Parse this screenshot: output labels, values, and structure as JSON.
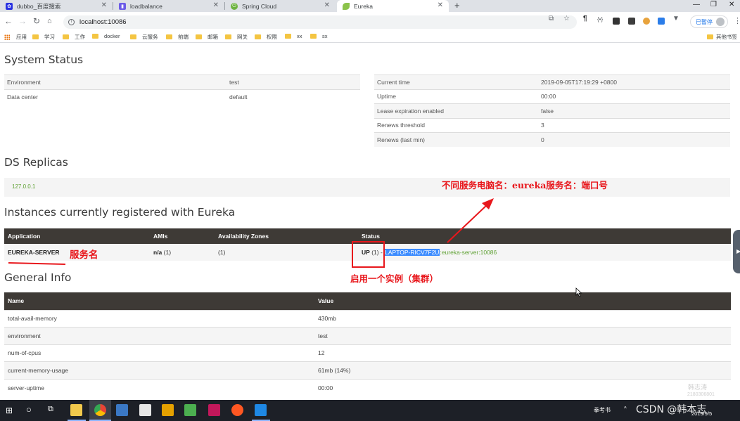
{
  "browser": {
    "tabs": [
      {
        "label": "dubbo_百度搜索",
        "icon": "baidu-paw-icon",
        "color": "#2932e1"
      },
      {
        "label": "loadbalance",
        "icon": "bookmark-page-icon",
        "color": "#6c5ce7"
      },
      {
        "label": "Spring Cloud",
        "icon": "spring-leaf-icon",
        "color": "#6db33f"
      },
      {
        "label": "Eureka",
        "icon": "eureka-leaf-icon",
        "color": "#8bc34a"
      }
    ],
    "url": "localhost:10086",
    "profile_label": "已暂停",
    "bookmarks": [
      "应用",
      "学习",
      "工作",
      "docker",
      "云服务",
      "前端",
      "邮箱",
      "网关",
      "权限",
      "xx",
      "sx"
    ],
    "other_bookmarks": "其他书签"
  },
  "system_status": {
    "title": "System Status",
    "left": [
      {
        "key": "Environment",
        "value": "test"
      },
      {
        "key": "Data center",
        "value": "default"
      }
    ],
    "right": [
      {
        "key": "Current time",
        "value": "2019-09-05T17:19:29 +0800"
      },
      {
        "key": "Uptime",
        "value": "00:00"
      },
      {
        "key": "Lease expiration enabled",
        "value": "false"
      },
      {
        "key": "Renews threshold",
        "value": "3"
      },
      {
        "key": "Renews (last min)",
        "value": "0"
      }
    ]
  },
  "ds_replicas": {
    "title": "DS Replicas",
    "link": "127.0.0.1"
  },
  "instances": {
    "title": "Instances currently registered with Eureka",
    "headers": [
      "Application",
      "AMIs",
      "Availability Zones",
      "Status"
    ],
    "row": {
      "application": "EUREKA-SERVER",
      "amis": "n/a",
      "amis_count": "(1)",
      "zones": "(1)",
      "status": "UP",
      "status_count": "(1)",
      "status_sep": " - ",
      "status_link_selected": "LAPTOP-RICV7F2U",
      "status_link_rest": ":eureka-server:10086"
    }
  },
  "general_info": {
    "title": "General Info",
    "headers": [
      "Name",
      "Value"
    ],
    "rows": [
      {
        "name": "total-avail-memory",
        "value": "430mb"
      },
      {
        "name": "environment",
        "value": "test"
      },
      {
        "name": "num-of-cpus",
        "value": "12"
      },
      {
        "name": "current-memory-usage",
        "value": "61mb (14%)"
      },
      {
        "name": "server-uptime",
        "value": "00:00"
      }
    ]
  },
  "annotations": {
    "top_note": "不同服务电脑名：eureka服务名：端口号",
    "service_name": "服务名",
    "cluster_note": "启用一个实例（集群）",
    "color": "#e8171c"
  },
  "overlays": {
    "watermark_name": "韩志涛",
    "watermark_id": "2180306801",
    "csdn": "CSDN @韩本志",
    "tray_ime": "拳考书"
  },
  "taskbar": {
    "date": "2019/9/5"
  }
}
